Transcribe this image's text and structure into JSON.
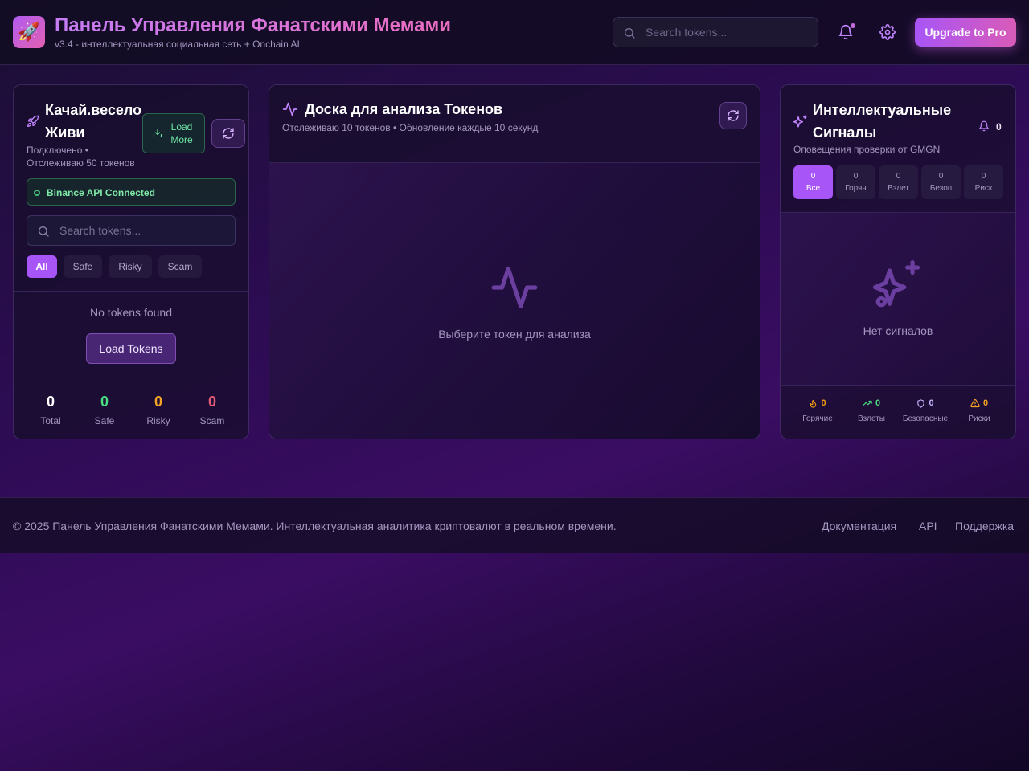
{
  "header": {
    "logo_icon": "rocket-emoji",
    "logo_glyph": "🚀",
    "title": "Панель Управления Фанатскими Мемами",
    "subtitle": "v3.4 - интеллектуальная социальная сеть + Onchain AI",
    "search_placeholder": "Search tokens...",
    "upgrade_label": "Upgrade to Pro"
  },
  "left_panel": {
    "title": "Качай.весело Живи",
    "status": "Подключено • Отслеживаю 50 токенов",
    "load_more_label": "Load More",
    "api_status": "Binance API Connected",
    "search_placeholder": "Search tokens...",
    "filters": [
      {
        "label": "All",
        "active": true
      },
      {
        "label": "Safe",
        "active": false
      },
      {
        "label": "Risky",
        "active": false
      },
      {
        "label": "Scam",
        "active": false
      }
    ],
    "empty_message": "No tokens found",
    "load_tokens_label": "Load Tokens",
    "stats": [
      {
        "value": "0",
        "label": "Total",
        "color": "#ffffff"
      },
      {
        "value": "0",
        "label": "Safe",
        "color": "#4ade80"
      },
      {
        "value": "0",
        "label": "Risky",
        "color": "#f5a524"
      },
      {
        "value": "0",
        "label": "Scam",
        "color": "#e45a74"
      }
    ]
  },
  "middle_panel": {
    "title": "Доска для анализа Токенов",
    "subtitle": "Отслеживаю 10 токенов • Обновление каждые 10 секунд",
    "empty_message": "Выберите токен для анализа"
  },
  "right_panel": {
    "title": "Интеллектуальные Сигналы",
    "subtitle": "Оповещения проверки от GMGN",
    "bell_count": "0",
    "tabs": [
      {
        "count": "0",
        "label": "Все",
        "active": true
      },
      {
        "count": "0",
        "label": "Горяч",
        "active": false
      },
      {
        "count": "0",
        "label": "Взлет",
        "active": false
      },
      {
        "count": "0",
        "label": "Безоп",
        "active": false
      },
      {
        "count": "0",
        "label": "Риск",
        "active": false
      }
    ],
    "empty_message": "Нет сигналов",
    "stats": [
      {
        "icon": "flame-icon",
        "value": "0",
        "label": "Горячие",
        "color": "#f59e0b"
      },
      {
        "icon": "trending-up-icon",
        "value": "0",
        "label": "Взлеты",
        "color": "#4ade80"
      },
      {
        "icon": "shield-icon",
        "value": "0",
        "label": "Безопасные",
        "color": "#c4b5fd"
      },
      {
        "icon": "warning-icon",
        "value": "0",
        "label": "Риски",
        "color": "#f5a524"
      }
    ]
  },
  "footer": {
    "copyright": "© 2025 Панель Управления Фанатскими Мемами. Интеллектуальная аналитика криптовалют в реальном времени.",
    "links": [
      "Документация",
      "API",
      "Поддержка"
    ]
  },
  "colors": {
    "accent": "#a855f7",
    "accent_pink": "#d95bb8",
    "success": "#4ade80",
    "warning": "#f5a524",
    "danger": "#e45a74"
  }
}
